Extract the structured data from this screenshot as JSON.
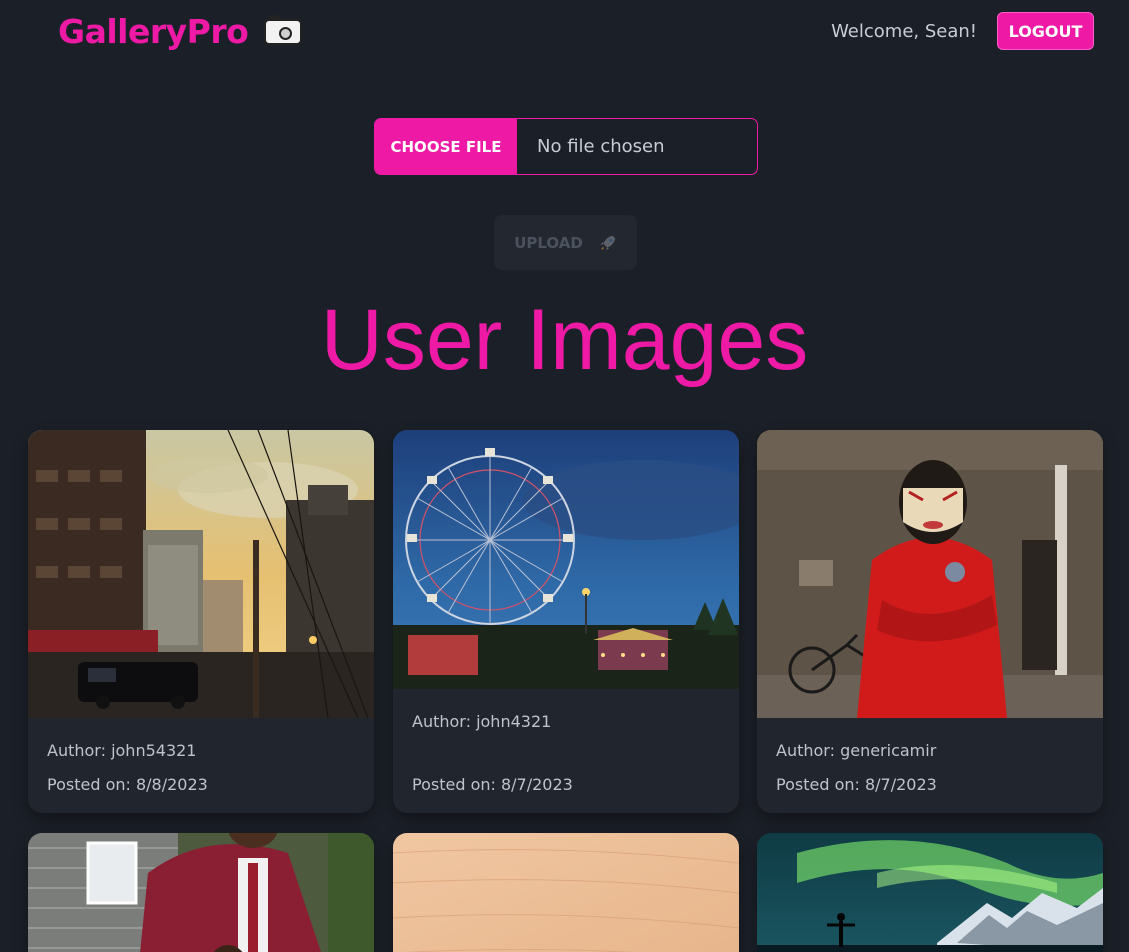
{
  "header": {
    "brand": "GalleryPro",
    "brand_icon": "camera-icon",
    "welcome": "Welcome, Sean!",
    "logout_label": "LOGOUT"
  },
  "uploader": {
    "choose_label": "CHOOSE FILE",
    "file_status": "No file chosen",
    "upload_label": "UPLOAD",
    "upload_icon": "rocket-icon"
  },
  "section": {
    "title": "User Images"
  },
  "images": [
    {
      "author": "Author: john54321",
      "posted": "Posted on: 8/8/2023"
    },
    {
      "author": "Author: john4321",
      "posted": "Posted on: 8/7/2023"
    },
    {
      "author": "Author: genericamir",
      "posted": "Posted on: 8/7/2023"
    },
    {
      "author": "",
      "posted": ""
    },
    {
      "author": "",
      "posted": ""
    },
    {
      "author": "",
      "posted": ""
    }
  ],
  "colors": {
    "background": "#1b1f27",
    "accent": "#ee1aa6",
    "card": "#20252e",
    "text": "#c9ccd4"
  }
}
